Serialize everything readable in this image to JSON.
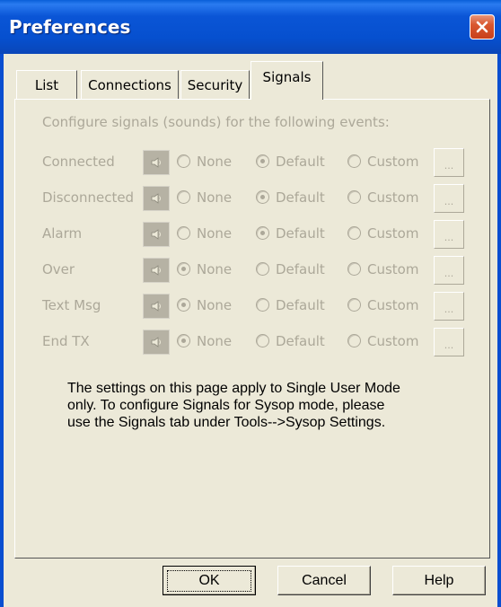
{
  "window": {
    "title": "Preferences",
    "close_icon": "close-icon"
  },
  "tabs": [
    {
      "label": "List",
      "active": false
    },
    {
      "label": "Connections",
      "active": false
    },
    {
      "label": "Security",
      "active": false
    },
    {
      "label": "Signals",
      "active": true
    }
  ],
  "signals": {
    "intro": "Configure signals (sounds) for the following events:",
    "option_labels": {
      "none": "None",
      "default": "Default",
      "custom": "Custom"
    },
    "browse_label": "...",
    "events": [
      {
        "label": "Connected",
        "selected": "default"
      },
      {
        "label": "Disconnected",
        "selected": "default"
      },
      {
        "label": "Alarm",
        "selected": "default"
      },
      {
        "label": "Over",
        "selected": "none"
      },
      {
        "label": "Text Msg",
        "selected": "none"
      },
      {
        "label": "End TX",
        "selected": "none"
      }
    ],
    "note": "The settings on this page apply to Single User Mode\nonly.  To configure Signals for Sysop mode, please\nuse the Signals tab under Tools-->Sysop Settings."
  },
  "buttons": {
    "ok": "OK",
    "cancel": "Cancel",
    "help": "Help"
  },
  "colors": {
    "titlebar": "#0a55d6",
    "close": "#d9572f",
    "dialog_bg": "#ece9d8",
    "disabled_text": "#aca899"
  }
}
